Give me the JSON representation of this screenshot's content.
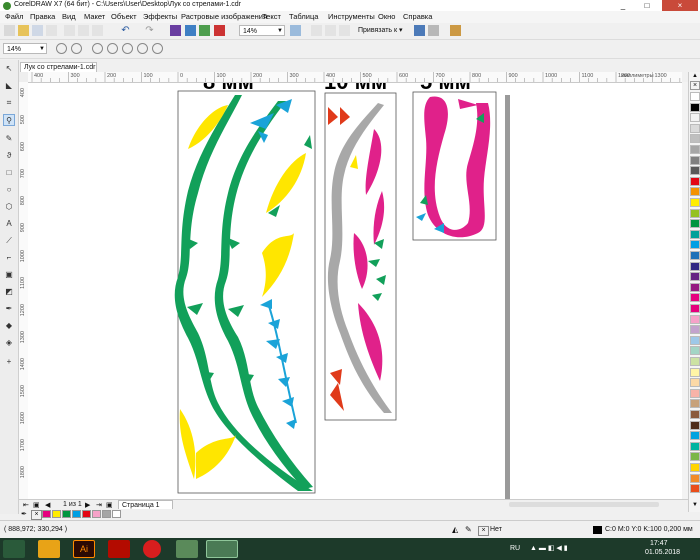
{
  "window": {
    "title": "CorelDRAW X7 (64 бит) - C:\\Users\\User\\Desktop\\Лук со стрелами-1.cdr",
    "controls": [
      "_",
      "□",
      "×"
    ]
  },
  "menu": [
    "Файл",
    "Правка",
    "Вид",
    "Макет",
    "Объект",
    "Эффекты",
    "Растровые изображения",
    "Текст",
    "Таблица",
    "Инструменты",
    "Окно",
    "Справка"
  ],
  "toolbar": {
    "zoom_value": "14%",
    "snap_label": "Привязать к"
  },
  "property_bar": {
    "zoom_value": "14%"
  },
  "document": {
    "tab_label": "Лук со стрелами-1.cdr",
    "page_counter": "1 из 1",
    "page_tab": "Страница 1",
    "ruler_unit": "миллиметры"
  },
  "ruler": {
    "h_ticks": [
      "400",
      "300",
      "200",
      "100",
      "0",
      "100",
      "200",
      "300",
      "400",
      "500",
      "600",
      "700",
      "800",
      "900",
      "1000",
      "1100",
      "1200",
      "1300",
      "1400",
      "1500",
      "1600"
    ],
    "v_ticks": [
      "400",
      "500",
      "600",
      "700",
      "800",
      "900",
      "1000",
      "1100",
      "1200",
      "1300",
      "1400",
      "1500",
      "1600",
      "1700",
      "1800"
    ]
  },
  "status": {
    "coordinates": "( 888,972; 330,294 )",
    "fill_label": "Нет",
    "outline_info": "C:0 M:0 Y:0 K:100  0,200 мм"
  },
  "taskbar": {
    "lang": "RU",
    "time": "17:47",
    "date": "01.05.2018"
  },
  "palette_colors": [
    "#ffffff",
    "#000000",
    "#f2f2f2",
    "#dadada",
    "#bfbfbf",
    "#a6a6a6",
    "#808080",
    "#595959",
    "#e30613",
    "#f39200",
    "#ffed00",
    "#95c11f",
    "#009640",
    "#00a19a",
    "#009fe3",
    "#1d71b8",
    "#312783",
    "#662483",
    "#951b81",
    "#e6007e",
    "#e5007d",
    "#f6a2c8",
    "#c3a3cd",
    "#9ec8e8",
    "#a3d5c5",
    "#cce2a3",
    "#fff5a6",
    "#fcd9a6",
    "#f7b3a8",
    "#c7a17a",
    "#8a5a3c",
    "#4d2c19",
    "#00a3e0",
    "#00b4a0",
    "#7ab648",
    "#ffd400",
    "#f28c28",
    "#e94e1b"
  ],
  "doc_palette": [
    "#e6007e",
    "#ffed00",
    "#009640",
    "#009fe3",
    "#e30613",
    "#f6a2c8",
    "#a6a6a6",
    "#ffffff"
  ]
}
